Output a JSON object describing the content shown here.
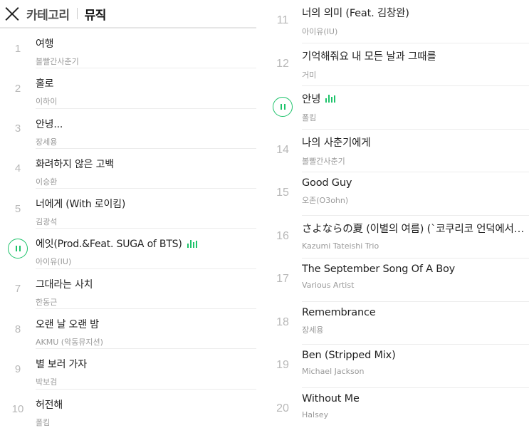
{
  "header": {
    "parent": "카테고리",
    "current": "뮤직"
  },
  "colors": {
    "accent": "#1ec36b",
    "divider": "#ececec"
  },
  "tracks": [
    {
      "num": "1",
      "title": "여행",
      "artist": "볼빨간사춘기",
      "playing": false
    },
    {
      "num": "2",
      "title": "홀로",
      "artist": "이하이",
      "playing": false
    },
    {
      "num": "3",
      "title": "안녕...",
      "artist": "장세용",
      "playing": false
    },
    {
      "num": "4",
      "title": "화려하지 않은 고백",
      "artist": "이승환",
      "playing": false
    },
    {
      "num": "5",
      "title": "너에게 (With 로이킴)",
      "artist": "김광석",
      "playing": false
    },
    {
      "num": "6",
      "title": "에잇(Prod.&Feat. SUGA of BTS)",
      "artist": "아이유(IU)",
      "playing": true
    },
    {
      "num": "7",
      "title": "그대라는 사치",
      "artist": "한동근",
      "playing": false
    },
    {
      "num": "8",
      "title": "오랜 날 오랜 밤",
      "artist": "AKMU (악동뮤지션)",
      "playing": false
    },
    {
      "num": "9",
      "title": "별 보러 가자",
      "artist": "박보검",
      "playing": false
    },
    {
      "num": "10",
      "title": "허전해",
      "artist": "폴킴",
      "playing": false
    },
    {
      "num": "11",
      "title": "너의 의미 (Feat. 김창완)",
      "artist": "아이유(IU)",
      "playing": false
    },
    {
      "num": "12",
      "title": "기억해줘요 내 모든 날과 그때를",
      "artist": "거미",
      "playing": false
    },
    {
      "num": "13",
      "title": "안녕",
      "artist": "폴킴",
      "playing": true
    },
    {
      "num": "14",
      "title": "나의 사춘기에게",
      "artist": "볼빨간사춘기",
      "playing": false
    },
    {
      "num": "15",
      "title": "Good Guy",
      "artist": "오존(O3ohn)",
      "playing": false
    },
    {
      "num": "16",
      "title": "さよならの夏 (이별의 여름) (`코쿠리코 언덕에서` OST)",
      "artist": "Kazumi Tateishi Trio",
      "playing": false
    },
    {
      "num": "17",
      "title": "The September Song Of A Boy",
      "artist": "Various Artist",
      "playing": false
    },
    {
      "num": "18",
      "title": "Remembrance",
      "artist": "장세용",
      "playing": false
    },
    {
      "num": "19",
      "title": "Ben (Stripped Mix)",
      "artist": "Michael Jackson",
      "playing": false
    },
    {
      "num": "20",
      "title": "Without Me",
      "artist": "Halsey",
      "playing": false
    }
  ]
}
